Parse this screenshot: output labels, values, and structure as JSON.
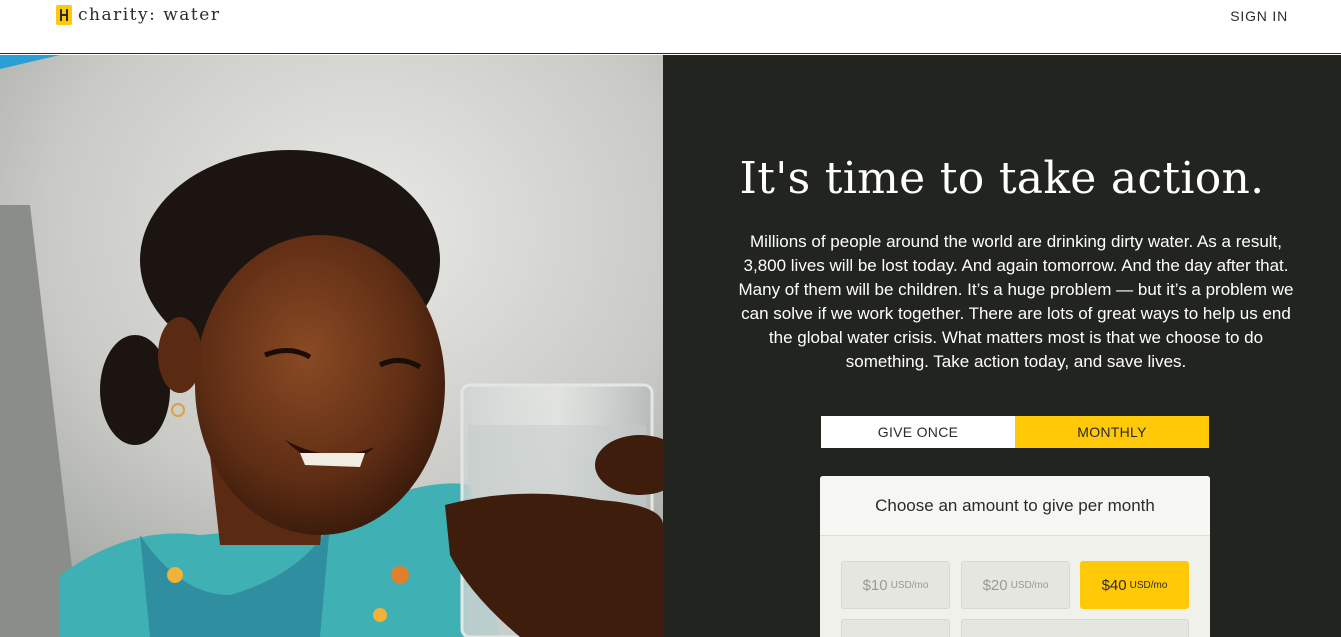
{
  "header": {
    "logo_text": "charity: water",
    "signin_label": "SIGN IN"
  },
  "photo": {
    "alt": "photo-girl-with-glass-icon"
  },
  "panel": {
    "headline": "It's time to take action.",
    "body": "Millions of people around the world are drinking dirty water. As a result, 3,800 lives will be lost today. And again tomorrow. And the day after that. Many of them will be children. It’s a huge problem — but it’s a problem we can solve if we work together. There are lots of great ways to help us end the global water crisis. What matters most is that we choose to do something. Take action today, and save lives.",
    "frequency": {
      "once_label": "GIVE ONCE",
      "monthly_label": "MONTHLY",
      "selected": "MONTHLY"
    },
    "amount_card": {
      "title": "Choose an amount to give per month",
      "options": [
        {
          "value": "$10",
          "unit": "USD/mo",
          "selected": false
        },
        {
          "value": "$20",
          "unit": "USD/mo",
          "selected": false
        },
        {
          "value": "$40",
          "unit": "USD/mo",
          "selected": true
        }
      ]
    }
  },
  "colors": {
    "accent": "#ffc907",
    "panel_bg": "#222420"
  }
}
